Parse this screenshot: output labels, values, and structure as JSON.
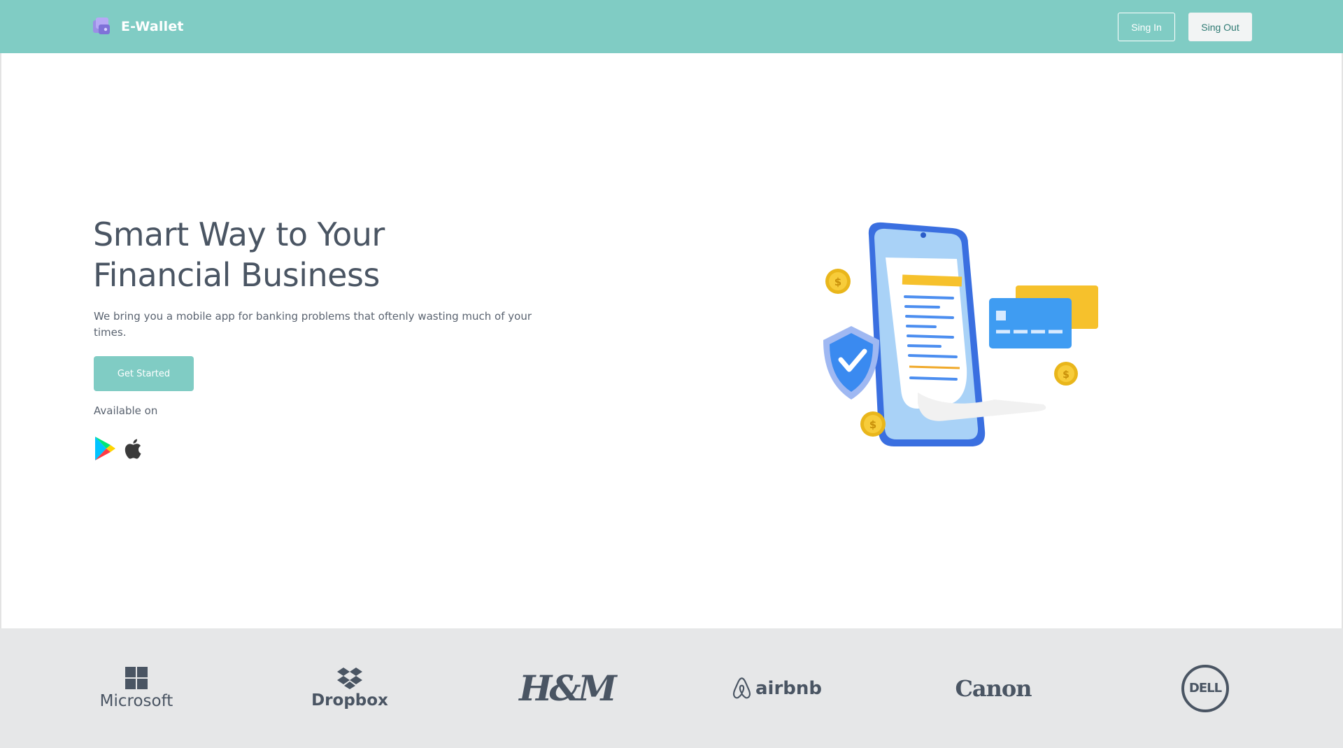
{
  "navbar": {
    "brand": "E-Wallet",
    "signin_label": "Sing In",
    "signout_label": "Sing Out"
  },
  "hero": {
    "title_line1": "Smart Way to Your",
    "title_line2": "Financial Business",
    "subtitle": "We bring you a mobile app for banking problems that oftenly wasting much of your times.",
    "cta_label": "Get Started",
    "available_label": "Available on",
    "stores": [
      "google-play-icon",
      "apple-icon"
    ]
  },
  "partners": {
    "microsoft": "Microsoft",
    "dropbox": "Dropbox",
    "hm": "H&M",
    "airbnb": "airbnb",
    "canon": "Canon",
    "dell": "DELL"
  },
  "colors": {
    "accent": "#80ccc4",
    "text": "#4a5563",
    "strip": "#e6e7e8"
  }
}
